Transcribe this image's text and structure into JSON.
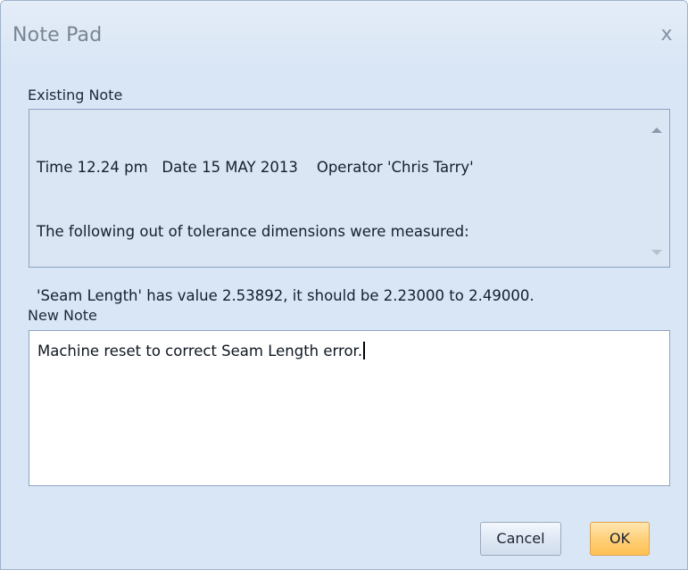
{
  "window": {
    "title": "Note Pad",
    "close_glyph": "x"
  },
  "existing_note": {
    "label": "Existing Note",
    "lines": [
      "Time 12.24 pm   Date 15 MAY 2013    Operator 'Chris Tarry'",
      "The following out of tolerance dimensions were measured:",
      "'Seam Length' has value 2.53892, it should be 2.23000 to 2.49000."
    ]
  },
  "new_note": {
    "label": "New Note",
    "value": "Machine reset to correct Seam Length error."
  },
  "buttons": {
    "cancel": "Cancel",
    "ok": "OK"
  },
  "colors": {
    "dialog_bg": "#d9e6f5",
    "ok_accent": "#ffc152",
    "border": "#8ba3c3"
  },
  "icons": {
    "close": "close-icon",
    "scroll_up": "scroll-up-arrow-icon",
    "scroll_down": "scroll-down-arrow-icon"
  }
}
